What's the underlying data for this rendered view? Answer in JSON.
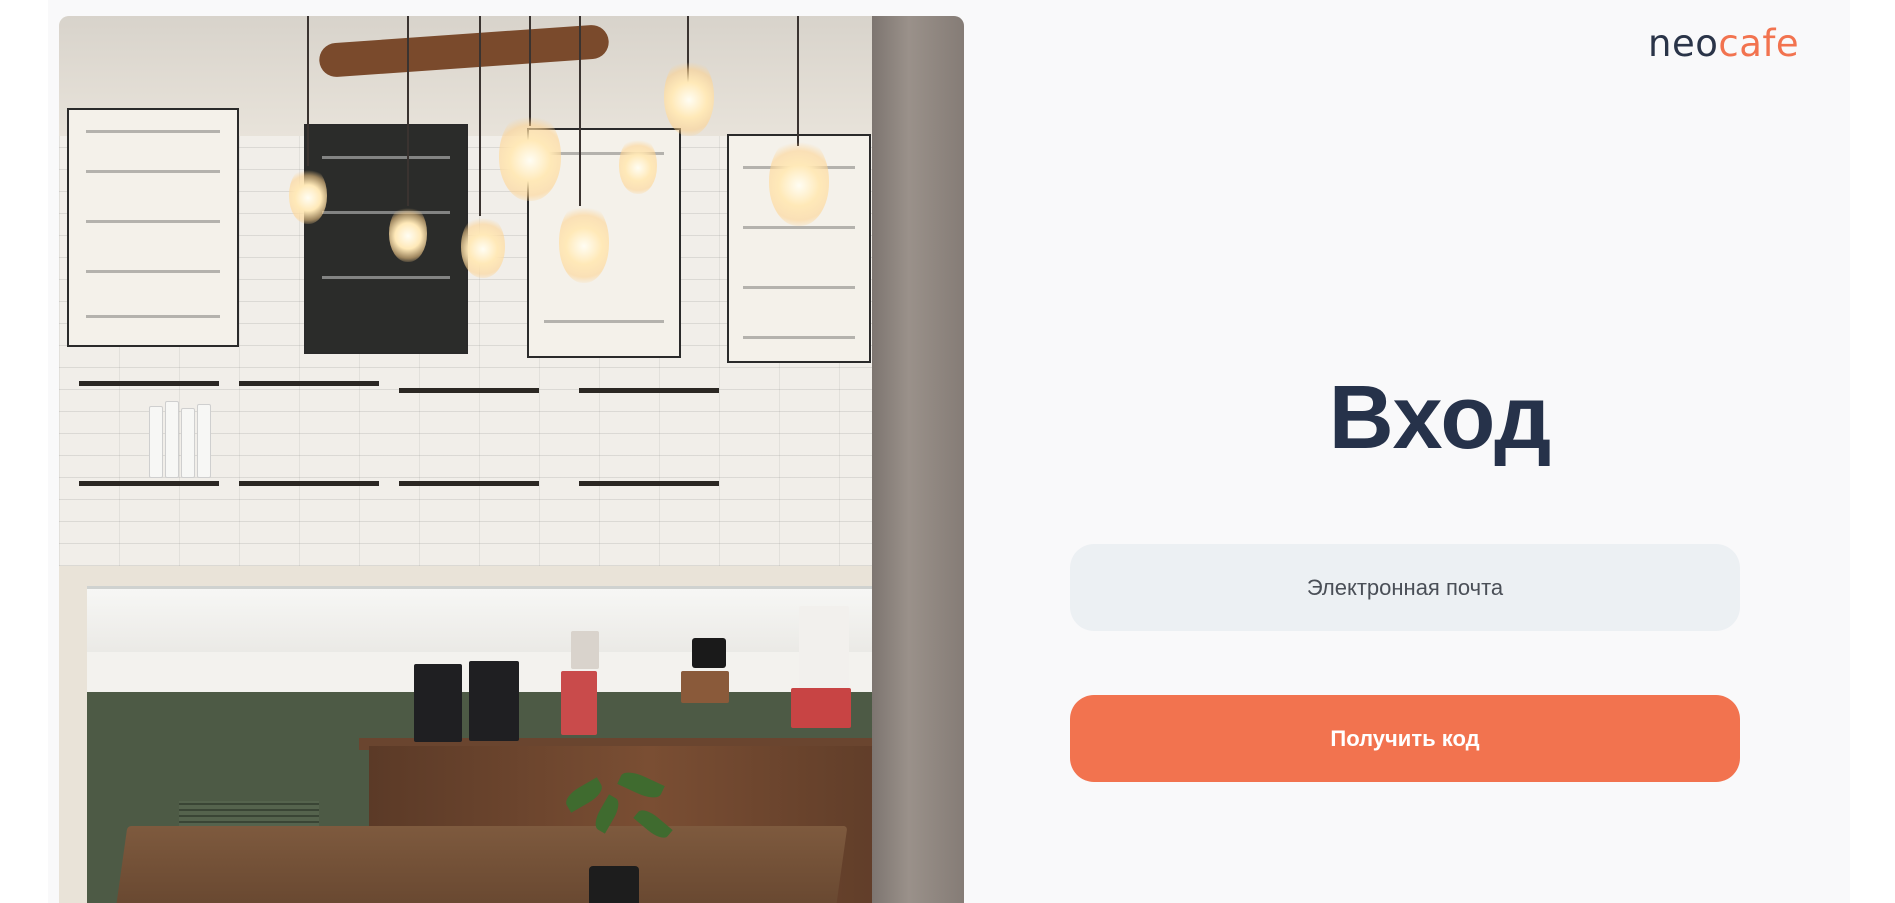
{
  "brand": {
    "logo_part1": "neo",
    "logo_part2": "cafe",
    "primary_color": "#f2734f",
    "dark_color": "#26324a"
  },
  "login": {
    "title": "Вход",
    "email_placeholder": "Электронная почта",
    "email_value": "",
    "submit_label": "Получить код"
  },
  "hero_image": {
    "subject": "cafe-interior-photo"
  }
}
